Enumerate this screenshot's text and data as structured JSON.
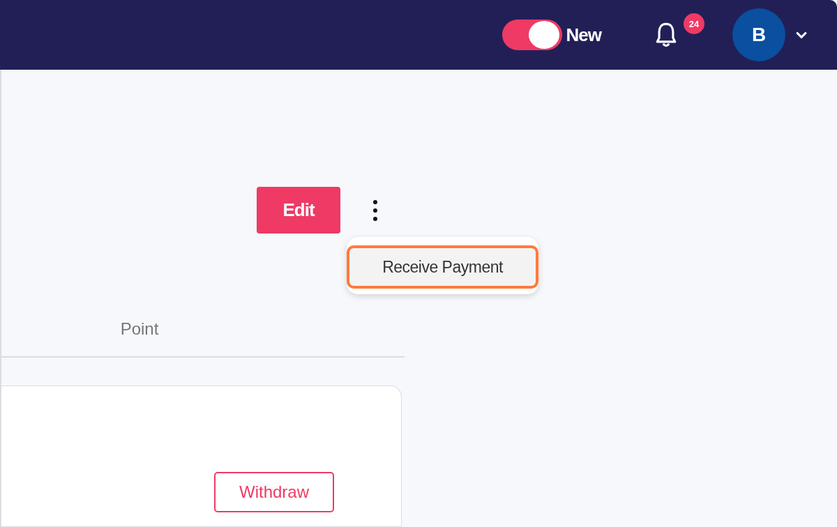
{
  "header": {
    "toggle": {
      "label": "New",
      "on": true
    },
    "notifications": {
      "count": "24"
    },
    "avatar": {
      "initial": "B"
    }
  },
  "actions": {
    "edit_button": "Edit",
    "menu": {
      "items": [
        {
          "label": "Receive Payment",
          "selected": true
        }
      ]
    }
  },
  "tabs": [
    {
      "label": "Point",
      "selected": false
    }
  ],
  "card": {
    "buttons": [
      "Withdraw"
    ]
  }
}
